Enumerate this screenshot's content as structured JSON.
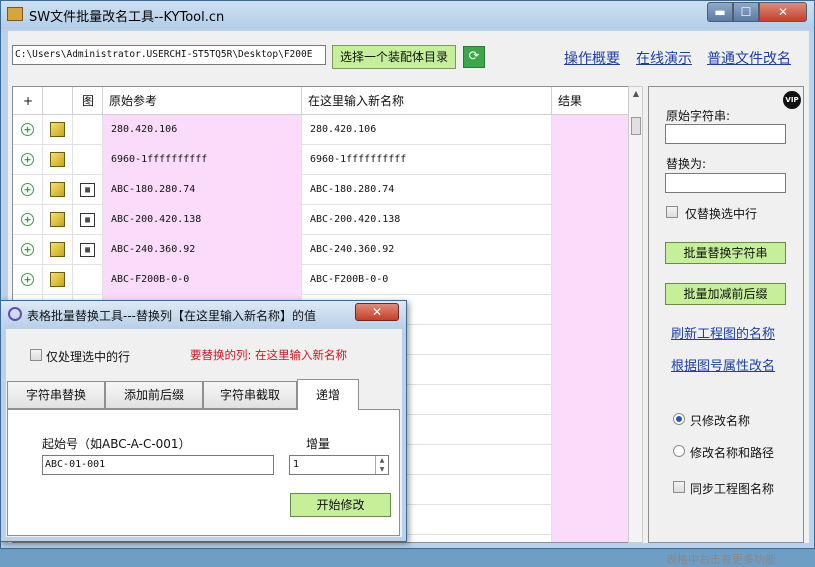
{
  "window": {
    "title": "SW文件批量改名工具--KYTool.cn",
    "min": "▬",
    "max": "☐",
    "close": "✕"
  },
  "toolbar": {
    "path_value": "C:\\Users\\Administrator.USERCHI-ST5TQ5R\\Desktop\\F200E",
    "select_button": "选择一个装配体目录",
    "refresh": "⟳",
    "links": [
      "操作概要",
      "在线演示",
      "普通文件改名"
    ]
  },
  "table": {
    "headers": [
      "+",
      "",
      "图",
      "原始参考",
      "在这里输入新名称",
      "结果"
    ],
    "rows": [
      {
        "orig": "280.420.106",
        "new": "280.420.106",
        "drawing": false
      },
      {
        "orig": "6960-1ffffffffff",
        "new": "6960-1ffffffffff",
        "drawing": false
      },
      {
        "orig": "ABC-180.280.74",
        "new": "ABC-180.280.74",
        "drawing": true
      },
      {
        "orig": "ABC-200.420.138",
        "new": "ABC-200.420.138",
        "drawing": true
      },
      {
        "orig": "ABC-240.360.92",
        "new": "ABC-240.360.92",
        "drawing": true
      },
      {
        "orig": "ABC-F200B-0-0",
        "new": "ABC-F200B-0-0",
        "drawing": false
      }
    ]
  },
  "right_panel": {
    "vip": "VIP",
    "find_label": "原始字符串:",
    "replace_label": "替换为:",
    "only_selected": "仅替换选中行",
    "batch_replace": "批量替换字符串",
    "batch_prefix": "批量加减前后缀",
    "refresh_drawing": "刷新工程图的名称",
    "rename_by_attr": "根据图号属性改名",
    "radio_only_name": "只修改名称",
    "radio_name_path": "修改名称和路径",
    "sync_drawing": "同步工程图名称",
    "hint": "表格中右击有更多功能"
  },
  "dialog": {
    "title": "表格批量替换工具---替换列【在这里输入新名称】的值",
    "close": "✕",
    "only_selected_rows": "仅处理选中的行",
    "target_column": "要替换的列: 在这里输入新名称",
    "tabs": [
      "字符串替换",
      "添加前后缀",
      "字符串截取",
      "递增"
    ],
    "start_label": "起始号（如ABC-A-C-001）",
    "start_value": "ABC-01-001",
    "increment_label": "增量",
    "increment_value": "1",
    "start_button": "开始修改"
  }
}
